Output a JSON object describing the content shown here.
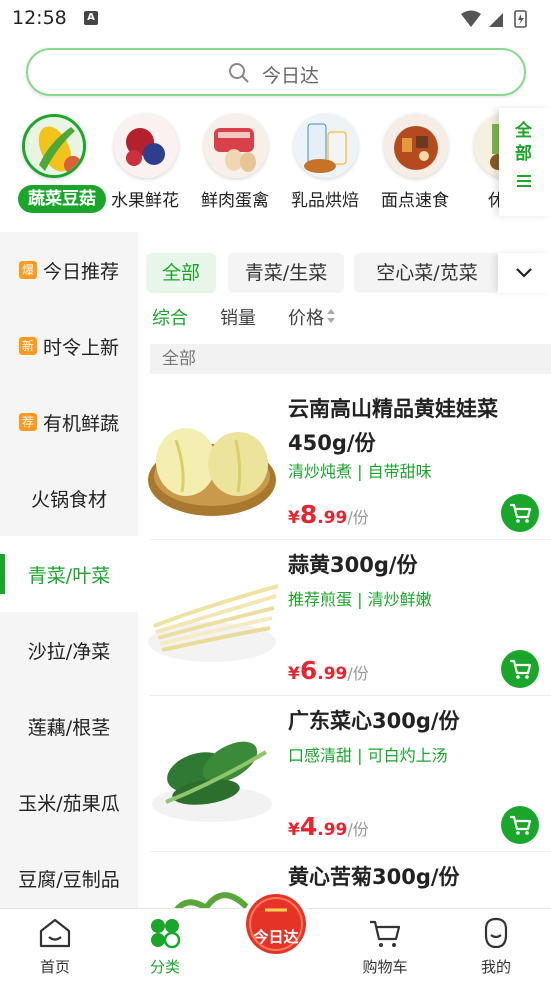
{
  "status_bar": {
    "time": "12:58",
    "notification_glyph": "A"
  },
  "search": {
    "placeholder": "今日达"
  },
  "categories": [
    {
      "label": "蔬菜豆菇",
      "active": true,
      "icon": "corn-vegetables-image"
    },
    {
      "label": "水果鲜花",
      "active": false,
      "icon": "berries-fruit-image"
    },
    {
      "label": "鲜肉蛋禽",
      "active": false,
      "icon": "meat-eggs-image"
    },
    {
      "label": "乳品烘焙",
      "active": false,
      "icon": "milk-bread-image"
    },
    {
      "label": "面点速食",
      "active": false,
      "icon": "noodles-food-image"
    },
    {
      "label": "休闲",
      "active": false,
      "icon": "snacks-image"
    }
  ],
  "all_categories": {
    "label": "全部"
  },
  "sidebar": {
    "items": [
      {
        "label": "今日推荐",
        "badge": "爆"
      },
      {
        "label": "时令上新",
        "badge": "新"
      },
      {
        "label": "有机鲜蔬",
        "badge": "荐"
      },
      {
        "label": "火锅食材",
        "badge": ""
      },
      {
        "label": "青菜/叶菜",
        "badge": "",
        "active": true
      },
      {
        "label": "沙拉/净菜",
        "badge": ""
      },
      {
        "label": "莲藕/根茎",
        "badge": ""
      },
      {
        "label": "玉米/茄果瓜",
        "badge": ""
      },
      {
        "label": "豆腐/豆制品",
        "badge": ""
      }
    ]
  },
  "filters": {
    "chips": [
      "全部",
      "青菜/生菜",
      "空心菜/苋菜"
    ],
    "sorts": [
      "综合",
      "销量",
      "价格"
    ],
    "section": "全部"
  },
  "products": [
    {
      "name": "云南高山精品黄娃娃菜450g/份",
      "desc": "清炒炖煮 | 自带甜味",
      "currency": "¥",
      "price_int": "8",
      "price_dec": ".99",
      "unit": "/份",
      "image": "napa-cabbage-image"
    },
    {
      "name": "蒜黄300g/份",
      "desc": "推荐煎蛋 | 清炒鲜嫩",
      "currency": "¥",
      "price_int": "6",
      "price_dec": ".99",
      "unit": "/份",
      "image": "garlic-chives-image"
    },
    {
      "name": "广东菜心300g/份",
      "desc": "口感清甜 | 可白灼上汤",
      "currency": "¥",
      "price_int": "4",
      "price_dec": ".99",
      "unit": "/份",
      "image": "choy-sum-image"
    },
    {
      "name": "黄心苦菊300g/份",
      "desc": "",
      "currency": "",
      "price_int": "",
      "price_dec": "",
      "unit": "",
      "image": "endive-image"
    }
  ],
  "bottom_nav": [
    {
      "label": "首页",
      "icon": "home-icon"
    },
    {
      "label": "分类",
      "icon": "category-icon",
      "active": true
    },
    {
      "label": "今日达",
      "icon": "today-delivery-icon"
    },
    {
      "label": "购物车",
      "icon": "cart-icon"
    },
    {
      "label": "我的",
      "icon": "profile-icon"
    }
  ],
  "colors": {
    "brand_green": "#1aa52b",
    "price_red": "#e8242e",
    "badge_orange": "#ff9a1f"
  }
}
